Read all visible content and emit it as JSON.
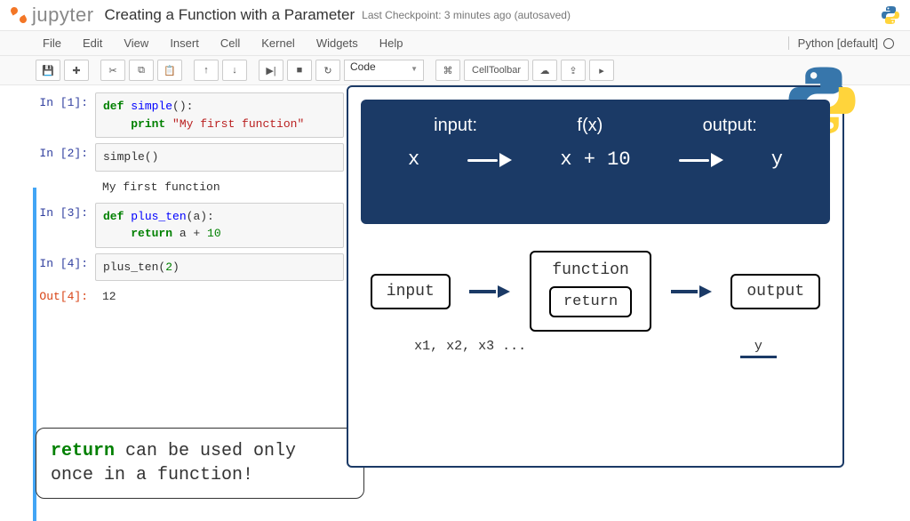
{
  "brand": "jupyter",
  "notebookTitle": "Creating a Function with a Parameter",
  "checkpoint": "Last Checkpoint: 3 minutes ago (autosaved)",
  "menus": {
    "file": "File",
    "edit": "Edit",
    "view": "View",
    "insert": "Insert",
    "cell": "Cell",
    "kernel": "Kernel",
    "widgets": "Widgets",
    "help": "Help"
  },
  "kernelIndicator": "Python [default]",
  "toolbar": {
    "cellType": "Code",
    "cellToolbar": "CellToolbar"
  },
  "cells": [
    {
      "inPrompt": "In [1]:",
      "codeLine1a": "def ",
      "codeLine1b": "simple",
      "codeLine1c": "():",
      "codeLine2a": "print ",
      "codeLine2b": "\"My first function\""
    },
    {
      "inPrompt": "In [2]:",
      "code": "simple()",
      "output": "My first function"
    },
    {
      "inPrompt": "In [3]:",
      "codeLine1a": "def ",
      "codeLine1b": "plus_ten",
      "codeLine1c": "(a):",
      "codeLine2a": "return ",
      "codeLine2b": "a + ",
      "codeLine2c": "10"
    },
    {
      "inPrompt": "In [4]:",
      "codePre": "plus_ten(",
      "codeNum": "2",
      "codePost": ")",
      "outPrompt": "Out[4]:",
      "output": "12"
    }
  ],
  "diagram": {
    "inputLabel": "input:",
    "fxLabel": "f(x)",
    "outputLabel": "output:",
    "x": "x",
    "expr": "x + 10",
    "y": "y",
    "boxInput": "input",
    "boxFunction": "function",
    "boxReturn": "return",
    "boxOutput": "output",
    "xList": "x1, x2, x3 ...",
    "yOut": "y"
  },
  "callout": {
    "ret": "return",
    "rest": " can be used only once in a function!"
  }
}
